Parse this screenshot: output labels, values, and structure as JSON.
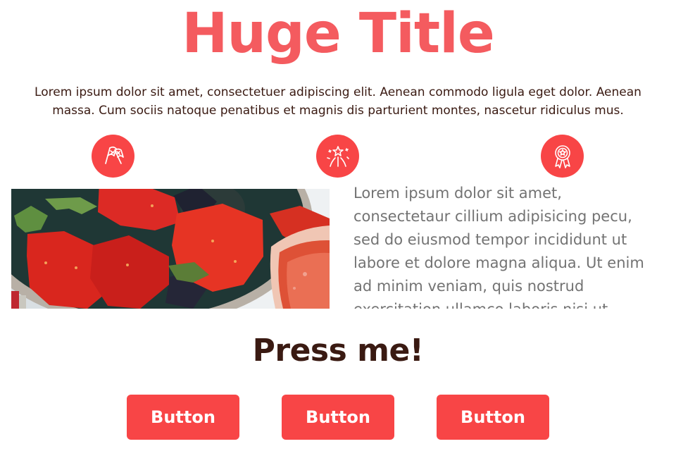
{
  "hero": {
    "title": "Huge Title",
    "intro": "Lorem ipsum dolor sit amet, consectetuer adipiscing elit. Aenean commodo ligula eget dolor. Aenean massa. Cum sociis natoque penatibus et magnis dis parturient montes, nascetur ridiculus mus."
  },
  "features": {
    "icons": [
      "flags-icon",
      "fireworks-icon",
      "award-ribbon-icon"
    ]
  },
  "content": {
    "body_lines": [
      "Lorem ipsum dolor sit amet,",
      "consectetaur cillium adipisicing pecu,",
      "sed do eiusmod tempor incididunt ut",
      "labore et dolore magna aliqua. Ut enim",
      "ad minim veniam, quis nostrud",
      "exercitation ullamco laboris nisi ut"
    ]
  },
  "cta": {
    "title": "Press me!",
    "buttons": [
      {
        "label": "Button"
      },
      {
        "label": "Button"
      },
      {
        "label": "Button"
      }
    ]
  },
  "colors": {
    "accent": "#f84546",
    "title": "#f45b5f",
    "text_dark": "#3a1a12",
    "text_gray": "#737373"
  }
}
